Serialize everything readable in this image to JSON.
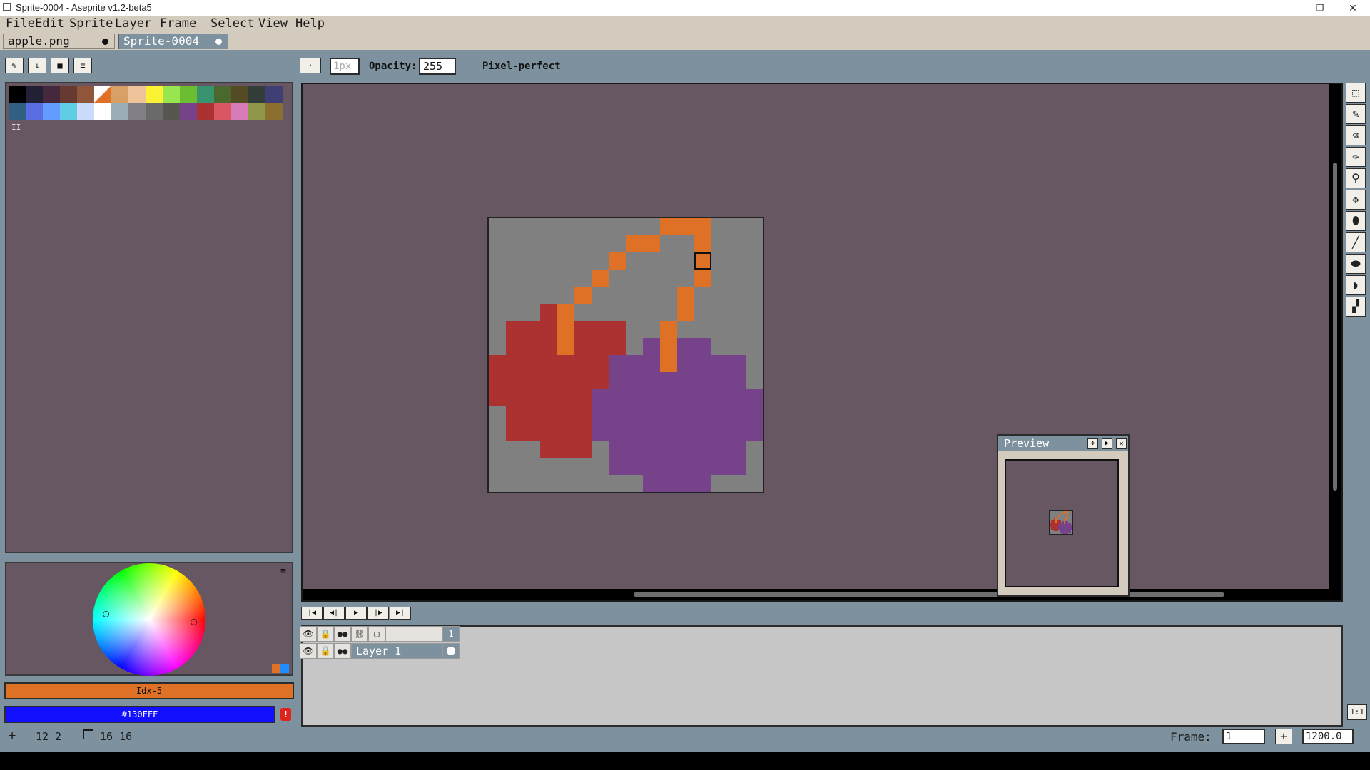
{
  "window": {
    "title": "Sprite-0004 - Aseprite v1.2-beta5",
    "minimize": "–",
    "restore": "❐",
    "close": "✕"
  },
  "menu": [
    "File",
    "Edit",
    "Sprite",
    "Layer",
    "Frame",
    "Select",
    "View",
    "Help"
  ],
  "tabs": [
    {
      "label": "apple.png",
      "active": false
    },
    {
      "label": "Sprite-0004",
      "active": true
    }
  ],
  "color_bar_buttons": [
    "edit-icon",
    "sort-icon",
    "presets-icon",
    "options-icon"
  ],
  "context_bar": {
    "brush_size": "1px",
    "opacity_label": "Opacity:",
    "opacity_value": "255",
    "pixel_perfect_label": "Pixel-perfect"
  },
  "palette": [
    "#000000",
    "#222034",
    "#45283c",
    "#663931",
    "#8f563b",
    "#df7126",
    "#d9a066",
    "#eec39a",
    "#fbf236",
    "#99e550",
    "#6abe30",
    "#37946e",
    "#4b692f",
    "#524b24",
    "#323c39",
    "#3f3f74",
    "#306082",
    "#5b6ee1",
    "#639bff",
    "#5fcde4",
    "#cbdbfc",
    "#ffffff",
    "#9badb7",
    "#847e87",
    "#696a6a",
    "#595652",
    "#76428a",
    "#ac3232",
    "#d95763",
    "#d77bba",
    "#8f974a",
    "#8a6f30"
  ],
  "palette_selected_index": 5,
  "palette_page_indicator": "II",
  "color_wheel_menu": "≡",
  "fg_color": {
    "label": "Idx-5",
    "hex": "#df7126"
  },
  "bg_color": {
    "label": "#130FFF",
    "hex": "#130fff"
  },
  "warning_icon": "!",
  "tools": [
    "rectangular-marquee-icon",
    "pencil-icon",
    "eraser-icon",
    "eyedropper-icon",
    "zoom-icon",
    "move-icon",
    "paint-bucket-icon",
    "line-icon",
    "ellipse-icon",
    "contour-icon",
    "blur-icon"
  ],
  "preview": {
    "title": "Preview"
  },
  "timeline": {
    "header_frame": "1",
    "layers": [
      {
        "name": "Layer 1"
      }
    ]
  },
  "status": {
    "cursor_pos": "12  2",
    "sprite_size": "16  16",
    "frame_label": "Frame:",
    "frame_value": "1",
    "add_frame": "+",
    "zoom_value": "1200.0",
    "zoom_reset": "1:1"
  },
  "sprite": {
    "width": 16,
    "height": 16,
    "background": "#808080",
    "pixels": [
      [
        10,
        0,
        "#df7126"
      ],
      [
        11,
        0,
        "#df7126"
      ],
      [
        12,
        0,
        "#df7126"
      ],
      [
        8,
        1,
        "#df7126"
      ],
      [
        9,
        1,
        "#df7126"
      ],
      [
        12,
        1,
        "#df7126"
      ],
      [
        7,
        2,
        "#df7126"
      ],
      [
        12,
        2,
        "#df7126"
      ],
      [
        6,
        3,
        "#df7126"
      ],
      [
        12,
        3,
        "#df7126"
      ],
      [
        5,
        4,
        "#df7126"
      ],
      [
        11,
        4,
        "#df7126"
      ],
      [
        3,
        5,
        "#ac3232"
      ],
      [
        4,
        5,
        "#df7126"
      ],
      [
        11,
        5,
        "#df7126"
      ],
      [
        1,
        6,
        "#ac3232"
      ],
      [
        2,
        6,
        "#ac3232"
      ],
      [
        3,
        6,
        "#ac3232"
      ],
      [
        4,
        6,
        "#df7126"
      ],
      [
        5,
        6,
        "#ac3232"
      ],
      [
        6,
        6,
        "#ac3232"
      ],
      [
        7,
        6,
        "#ac3232"
      ],
      [
        10,
        6,
        "#df7126"
      ],
      [
        1,
        7,
        "#ac3232"
      ],
      [
        2,
        7,
        "#ac3232"
      ],
      [
        3,
        7,
        "#ac3232"
      ],
      [
        4,
        7,
        "#df7126"
      ],
      [
        5,
        7,
        "#ac3232"
      ],
      [
        6,
        7,
        "#ac3232"
      ],
      [
        7,
        7,
        "#ac3232"
      ],
      [
        9,
        7,
        "#76428a"
      ],
      [
        10,
        7,
        "#df7126"
      ],
      [
        11,
        7,
        "#76428a"
      ],
      [
        12,
        7,
        "#76428a"
      ],
      [
        0,
        8,
        "#ac3232"
      ],
      [
        1,
        8,
        "#ac3232"
      ],
      [
        2,
        8,
        "#ac3232"
      ],
      [
        3,
        8,
        "#ac3232"
      ],
      [
        4,
        8,
        "#ac3232"
      ],
      [
        5,
        8,
        "#ac3232"
      ],
      [
        6,
        8,
        "#ac3232"
      ],
      [
        7,
        8,
        "#76428a"
      ],
      [
        8,
        8,
        "#76428a"
      ],
      [
        9,
        8,
        "#76428a"
      ],
      [
        10,
        8,
        "#df7126"
      ],
      [
        11,
        8,
        "#76428a"
      ],
      [
        12,
        8,
        "#76428a"
      ],
      [
        13,
        8,
        "#76428a"
      ],
      [
        14,
        8,
        "#76428a"
      ],
      [
        0,
        9,
        "#ac3232"
      ],
      [
        1,
        9,
        "#ac3232"
      ],
      [
        2,
        9,
        "#ac3232"
      ],
      [
        3,
        9,
        "#ac3232"
      ],
      [
        4,
        9,
        "#ac3232"
      ],
      [
        5,
        9,
        "#ac3232"
      ],
      [
        6,
        9,
        "#ac3232"
      ],
      [
        7,
        9,
        "#76428a"
      ],
      [
        8,
        9,
        "#76428a"
      ],
      [
        9,
        9,
        "#76428a"
      ],
      [
        10,
        9,
        "#76428a"
      ],
      [
        11,
        9,
        "#76428a"
      ],
      [
        12,
        9,
        "#76428a"
      ],
      [
        13,
        9,
        "#76428a"
      ],
      [
        14,
        9,
        "#76428a"
      ],
      [
        0,
        10,
        "#ac3232"
      ],
      [
        1,
        10,
        "#ac3232"
      ],
      [
        2,
        10,
        "#ac3232"
      ],
      [
        3,
        10,
        "#ac3232"
      ],
      [
        4,
        10,
        "#ac3232"
      ],
      [
        5,
        10,
        "#ac3232"
      ],
      [
        6,
        10,
        "#76428a"
      ],
      [
        7,
        10,
        "#76428a"
      ],
      [
        8,
        10,
        "#76428a"
      ],
      [
        9,
        10,
        "#76428a"
      ],
      [
        10,
        10,
        "#76428a"
      ],
      [
        11,
        10,
        "#76428a"
      ],
      [
        12,
        10,
        "#76428a"
      ],
      [
        13,
        10,
        "#76428a"
      ],
      [
        14,
        10,
        "#76428a"
      ],
      [
        15,
        10,
        "#76428a"
      ],
      [
        1,
        11,
        "#ac3232"
      ],
      [
        2,
        11,
        "#ac3232"
      ],
      [
        3,
        11,
        "#ac3232"
      ],
      [
        4,
        11,
        "#ac3232"
      ],
      [
        5,
        11,
        "#ac3232"
      ],
      [
        6,
        11,
        "#76428a"
      ],
      [
        7,
        11,
        "#76428a"
      ],
      [
        8,
        11,
        "#76428a"
      ],
      [
        9,
        11,
        "#76428a"
      ],
      [
        10,
        11,
        "#76428a"
      ],
      [
        11,
        11,
        "#76428a"
      ],
      [
        12,
        11,
        "#76428a"
      ],
      [
        13,
        11,
        "#76428a"
      ],
      [
        14,
        11,
        "#76428a"
      ],
      [
        15,
        11,
        "#76428a"
      ],
      [
        1,
        12,
        "#ac3232"
      ],
      [
        2,
        12,
        "#ac3232"
      ],
      [
        3,
        12,
        "#ac3232"
      ],
      [
        4,
        12,
        "#ac3232"
      ],
      [
        5,
        12,
        "#ac3232"
      ],
      [
        6,
        12,
        "#76428a"
      ],
      [
        7,
        12,
        "#76428a"
      ],
      [
        8,
        12,
        "#76428a"
      ],
      [
        9,
        12,
        "#76428a"
      ],
      [
        10,
        12,
        "#76428a"
      ],
      [
        11,
        12,
        "#76428a"
      ],
      [
        12,
        12,
        "#76428a"
      ],
      [
        13,
        12,
        "#76428a"
      ],
      [
        14,
        12,
        "#76428a"
      ],
      [
        15,
        12,
        "#76428a"
      ],
      [
        3,
        13,
        "#ac3232"
      ],
      [
        4,
        13,
        "#ac3232"
      ],
      [
        5,
        13,
        "#ac3232"
      ],
      [
        7,
        13,
        "#76428a"
      ],
      [
        8,
        13,
        "#76428a"
      ],
      [
        9,
        13,
        "#76428a"
      ],
      [
        10,
        13,
        "#76428a"
      ],
      [
        11,
        13,
        "#76428a"
      ],
      [
        12,
        13,
        "#76428a"
      ],
      [
        13,
        13,
        "#76428a"
      ],
      [
        14,
        13,
        "#76428a"
      ],
      [
        7,
        14,
        "#76428a"
      ],
      [
        8,
        14,
        "#76428a"
      ],
      [
        9,
        14,
        "#76428a"
      ],
      [
        10,
        14,
        "#76428a"
      ],
      [
        11,
        14,
        "#76428a"
      ],
      [
        12,
        14,
        "#76428a"
      ],
      [
        13,
        14,
        "#76428a"
      ],
      [
        14,
        14,
        "#76428a"
      ],
      [
        9,
        15,
        "#76428a"
      ],
      [
        10,
        15,
        "#76428a"
      ],
      [
        11,
        15,
        "#76428a"
      ],
      [
        12,
        15,
        "#76428a"
      ]
    ],
    "cursor_cell": [
      12,
      2
    ]
  }
}
